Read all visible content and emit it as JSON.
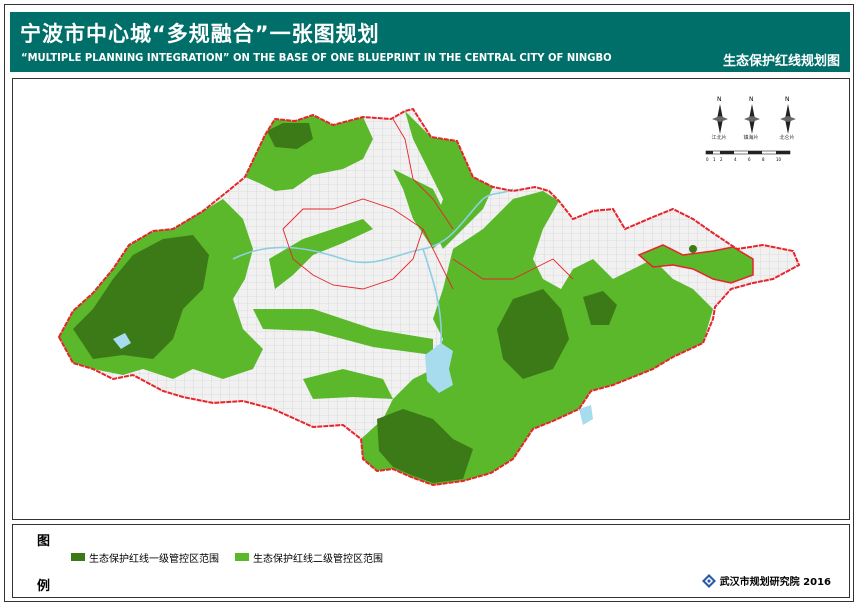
{
  "header": {
    "title_cn": "宁波市中心城“多规融合”一张图规划",
    "title_en": "“MULTIPLE PLANNING INTEGRATION” ON THE BASE OF ONE BLUEPRINT IN THE CENTRAL CITY OF NINGBO",
    "subtitle": "生态保护红线规划图"
  },
  "compass": {
    "letter": "N",
    "roses": [
      "江北片",
      "镇海片",
      "北仑片"
    ]
  },
  "scale_bar": {
    "ticks": [
      "0",
      "1",
      "2",
      "4",
      "6",
      "8",
      "10"
    ]
  },
  "legend": {
    "heading_top": "图",
    "heading_bottom": "例",
    "items": [
      {
        "label": "生态保护红线一级管控区范围",
        "color": "#3c7a18"
      },
      {
        "label": "生态保护红线二级管控区范围",
        "color": "#5ab82a"
      }
    ]
  },
  "organization": {
    "name_year": "武汉市规划研究院  2016"
  },
  "colors": {
    "header_bg": "#006f6a",
    "boundary_red": "#e8232a",
    "level1_green": "#3c7a18",
    "level2_green": "#5ab82a",
    "water": "#a6dced",
    "urban_fill": "#efefef"
  }
}
